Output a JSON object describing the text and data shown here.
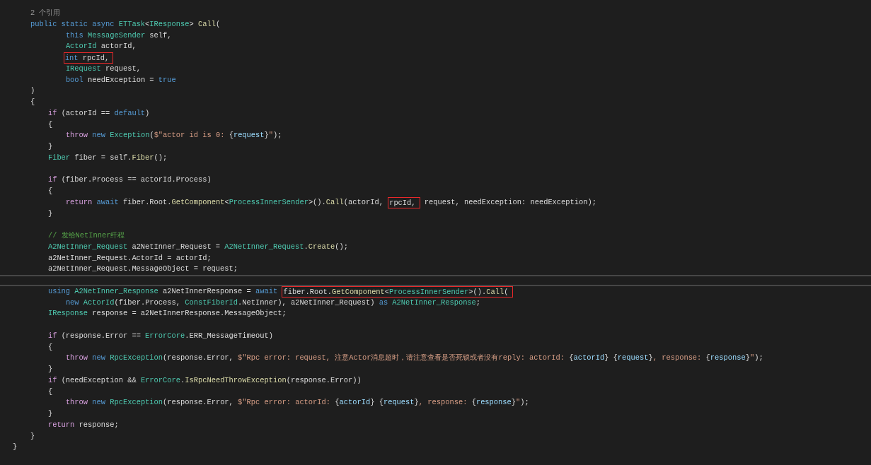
{
  "editor": {
    "lines": [
      {
        "kind": "codelens",
        "text": "    2 个引用"
      },
      {
        "kind": "code",
        "segments": [
          {
            "boxed": false,
            "tokens": [
              {
                "kind": "keyword",
                "text": "    public static async "
              },
              {
                "kind": "type",
                "text": "ETTask"
              },
              {
                "kind": "plain",
                "text": "<"
              },
              {
                "kind": "type",
                "text": "IResponse"
              },
              {
                "kind": "plain",
                "text": "> "
              },
              {
                "kind": "method",
                "text": "Call"
              },
              {
                "kind": "plain",
                "text": "("
              }
            ]
          }
        ]
      },
      {
        "kind": "code",
        "segments": [
          {
            "boxed": false,
            "tokens": [
              {
                "kind": "keyword",
                "text": "            this "
              },
              {
                "kind": "type",
                "text": "MessageSender"
              },
              {
                "kind": "plain",
                "text": " self,"
              }
            ]
          }
        ]
      },
      {
        "kind": "code",
        "segments": [
          {
            "boxed": false,
            "tokens": [
              {
                "kind": "type",
                "text": "            ActorId"
              },
              {
                "kind": "plain",
                "text": " actorId,"
              }
            ]
          }
        ]
      },
      {
        "kind": "code",
        "segments": [
          {
            "boxed": true,
            "tokens": [
              {
                "kind": "keyword",
                "text": "            int"
              },
              {
                "kind": "plain",
                "text": " rpcId,"
              }
            ]
          }
        ]
      },
      {
        "kind": "code",
        "segments": [
          {
            "boxed": false,
            "tokens": [
              {
                "kind": "type",
                "text": "            IRequest"
              },
              {
                "kind": "plain",
                "text": " request,"
              }
            ]
          }
        ]
      },
      {
        "kind": "code",
        "segments": [
          {
            "boxed": false,
            "tokens": [
              {
                "kind": "keyword",
                "text": "            bool"
              },
              {
                "kind": "plain",
                "text": " needException = "
              },
              {
                "kind": "keyword",
                "text": "true"
              }
            ]
          }
        ]
      },
      {
        "kind": "code",
        "segments": [
          {
            "boxed": false,
            "tokens": [
              {
                "kind": "plain",
                "text": "    )"
              }
            ]
          }
        ]
      },
      {
        "kind": "code",
        "segments": [
          {
            "boxed": false,
            "tokens": [
              {
                "kind": "plain",
                "text": "    {"
              }
            ]
          }
        ]
      },
      {
        "kind": "code",
        "segments": [
          {
            "boxed": false,
            "tokens": [
              {
                "kind": "control",
                "text": "        if"
              },
              {
                "kind": "plain",
                "text": " (actorId == "
              },
              {
                "kind": "keyword",
                "text": "default"
              },
              {
                "kind": "plain",
                "text": ")"
              }
            ]
          }
        ]
      },
      {
        "kind": "code",
        "segments": [
          {
            "boxed": false,
            "tokens": [
              {
                "kind": "plain",
                "text": "        {"
              }
            ]
          }
        ]
      },
      {
        "kind": "code",
        "segments": [
          {
            "boxed": false,
            "tokens": [
              {
                "kind": "control",
                "text": "            throw "
              },
              {
                "kind": "keyword",
                "text": "new "
              },
              {
                "kind": "type",
                "text": "Exception"
              },
              {
                "kind": "plain",
                "text": "("
              },
              {
                "kind": "string",
                "text": "$\"actor id is 0: "
              },
              {
                "kind": "plain",
                "text": "{"
              },
              {
                "kind": "interp",
                "text": "request"
              },
              {
                "kind": "plain",
                "text": "}"
              },
              {
                "kind": "string",
                "text": "\""
              },
              {
                "kind": "plain",
                "text": ");"
              }
            ]
          }
        ]
      },
      {
        "kind": "code",
        "segments": [
          {
            "boxed": false,
            "tokens": [
              {
                "kind": "plain",
                "text": "        }"
              }
            ]
          }
        ]
      },
      {
        "kind": "code",
        "segments": [
          {
            "boxed": false,
            "tokens": [
              {
                "kind": "type",
                "text": "        Fiber"
              },
              {
                "kind": "plain",
                "text": " fiber = self."
              },
              {
                "kind": "method",
                "text": "Fiber"
              },
              {
                "kind": "plain",
                "text": "();"
              }
            ]
          }
        ]
      },
      {
        "kind": "blank"
      },
      {
        "kind": "code",
        "segments": [
          {
            "boxed": false,
            "tokens": [
              {
                "kind": "control",
                "text": "        if"
              },
              {
                "kind": "plain",
                "text": " (fiber.Process == actorId.Process)"
              }
            ]
          }
        ]
      },
      {
        "kind": "code",
        "segments": [
          {
            "boxed": false,
            "tokens": [
              {
                "kind": "plain",
                "text": "        {"
              }
            ]
          }
        ]
      },
      {
        "kind": "code",
        "segments": [
          {
            "boxed": false,
            "tokens": [
              {
                "kind": "control",
                "text": "            return "
              },
              {
                "kind": "keyword",
                "text": "await"
              },
              {
                "kind": "plain",
                "text": " fiber.Root."
              },
              {
                "kind": "method",
                "text": "GetComponent"
              },
              {
                "kind": "plain",
                "text": "<"
              },
              {
                "kind": "type",
                "text": "ProcessInnerSender"
              },
              {
                "kind": "plain",
                "text": ">()."
              },
              {
                "kind": "method",
                "text": "Call"
              },
              {
                "kind": "plain",
                "text": "(actorId,"
              }
            ]
          },
          {
            "boxed": true,
            "tokens": [
              {
                "kind": "plain",
                "text": "rpcId,"
              }
            ]
          },
          {
            "boxed": false,
            "tokens": [
              {
                "kind": "plain",
                "text": "request, needException: needException);"
              }
            ]
          }
        ]
      },
      {
        "kind": "code",
        "segments": [
          {
            "boxed": false,
            "tokens": [
              {
                "kind": "plain",
                "text": "        }"
              }
            ]
          }
        ]
      },
      {
        "kind": "blank"
      },
      {
        "kind": "code",
        "segments": [
          {
            "boxed": false,
            "tokens": [
              {
                "kind": "comment",
                "text": "        // 发给NetInner纤程"
              }
            ]
          }
        ]
      },
      {
        "kind": "code",
        "segments": [
          {
            "boxed": false,
            "tokens": [
              {
                "kind": "type",
                "text": "        A2NetInner_Request"
              },
              {
                "kind": "plain",
                "text": " a2NetInner_Request = "
              },
              {
                "kind": "type",
                "text": "A2NetInner_Request"
              },
              {
                "kind": "plain",
                "text": "."
              },
              {
                "kind": "method",
                "text": "Create"
              },
              {
                "kind": "plain",
                "text": "();"
              }
            ]
          }
        ]
      },
      {
        "kind": "code",
        "segments": [
          {
            "boxed": false,
            "tokens": [
              {
                "kind": "plain",
                "text": "        a2NetInner_Request.ActorId = actorId;"
              }
            ]
          }
        ]
      },
      {
        "kind": "code",
        "segments": [
          {
            "boxed": false,
            "tokens": [
              {
                "kind": "plain",
                "text": "        a2NetInner_Request.MessageObject = request;"
              }
            ]
          }
        ]
      },
      {
        "kind": "separator"
      },
      {
        "kind": "code",
        "segments": [
          {
            "boxed": false,
            "tokens": [
              {
                "kind": "keyword",
                "text": "        using "
              },
              {
                "kind": "type",
                "text": "A2NetInner_Response"
              },
              {
                "kind": "plain",
                "text": " a2NetInnerResponse = "
              },
              {
                "kind": "keyword",
                "text": "await"
              }
            ]
          },
          {
            "boxed": true,
            "tokens": [
              {
                "kind": "plain",
                "text": "fiber.Root."
              },
              {
                "kind": "method",
                "text": "GetComponent"
              },
              {
                "kind": "plain",
                "text": "<"
              },
              {
                "kind": "type",
                "text": "ProcessInnerSender"
              },
              {
                "kind": "plain",
                "text": ">()."
              },
              {
                "kind": "method",
                "text": "Call"
              },
              {
                "kind": "plain",
                "text": "("
              }
            ]
          }
        ]
      },
      {
        "kind": "code",
        "segments": [
          {
            "boxed": false,
            "tokens": [
              {
                "kind": "keyword",
                "text": "            new "
              },
              {
                "kind": "type",
                "text": "ActorId"
              },
              {
                "kind": "plain",
                "text": "(fiber.Process, "
              },
              {
                "kind": "type",
                "text": "ConstFiberId"
              },
              {
                "kind": "plain",
                "text": ".NetInner), a2NetInner_Request) "
              },
              {
                "kind": "keyword",
                "text": "as "
              },
              {
                "kind": "type",
                "text": "A2NetInner_Response"
              },
              {
                "kind": "plain",
                "text": ";"
              }
            ]
          }
        ]
      },
      {
        "kind": "code",
        "segments": [
          {
            "boxed": false,
            "tokens": [
              {
                "kind": "type",
                "text": "        IResponse"
              },
              {
                "kind": "plain",
                "text": " response = a2NetInnerResponse.MessageObject;"
              }
            ]
          }
        ]
      },
      {
        "kind": "blank"
      },
      {
        "kind": "code",
        "segments": [
          {
            "boxed": false,
            "tokens": [
              {
                "kind": "control",
                "text": "        if"
              },
              {
                "kind": "plain",
                "text": " (response.Error == "
              },
              {
                "kind": "type",
                "text": "ErrorCore"
              },
              {
                "kind": "plain",
                "text": ".ERR_MessageTimeout)"
              }
            ]
          }
        ]
      },
      {
        "kind": "code",
        "segments": [
          {
            "boxed": false,
            "tokens": [
              {
                "kind": "plain",
                "text": "        {"
              }
            ]
          }
        ]
      },
      {
        "kind": "code",
        "segments": [
          {
            "boxed": false,
            "tokens": [
              {
                "kind": "control",
                "text": "            throw "
              },
              {
                "kind": "keyword",
                "text": "new "
              },
              {
                "kind": "type",
                "text": "RpcException"
              },
              {
                "kind": "plain",
                "text": "(response.Error, "
              },
              {
                "kind": "string",
                "text": "$\"Rpc error: request, 注意Actor消息超时，请注意查看是否死锁或者没有reply: actorId: "
              },
              {
                "kind": "plain",
                "text": "{"
              },
              {
                "kind": "interp",
                "text": "actorId"
              },
              {
                "kind": "plain",
                "text": "} {"
              },
              {
                "kind": "interp",
                "text": "request"
              },
              {
                "kind": "plain",
                "text": "}"
              },
              {
                "kind": "string",
                "text": ", response: "
              },
              {
                "kind": "plain",
                "text": "{"
              },
              {
                "kind": "interp",
                "text": "response"
              },
              {
                "kind": "plain",
                "text": "}"
              },
              {
                "kind": "string",
                "text": "\""
              },
              {
                "kind": "plain",
                "text": ");"
              }
            ]
          }
        ]
      },
      {
        "kind": "code",
        "segments": [
          {
            "boxed": false,
            "tokens": [
              {
                "kind": "plain",
                "text": "        }"
              }
            ]
          }
        ]
      },
      {
        "kind": "code",
        "segments": [
          {
            "boxed": false,
            "tokens": [
              {
                "kind": "control",
                "text": "        if"
              },
              {
                "kind": "plain",
                "text": " (needException && "
              },
              {
                "kind": "type",
                "text": "ErrorCore"
              },
              {
                "kind": "plain",
                "text": "."
              },
              {
                "kind": "method",
                "text": "IsRpcNeedThrowException"
              },
              {
                "kind": "plain",
                "text": "(response.Error))"
              }
            ]
          }
        ]
      },
      {
        "kind": "code",
        "segments": [
          {
            "boxed": false,
            "tokens": [
              {
                "kind": "plain",
                "text": "        {"
              }
            ]
          }
        ]
      },
      {
        "kind": "code",
        "segments": [
          {
            "boxed": false,
            "tokens": [
              {
                "kind": "control",
                "text": "            throw "
              },
              {
                "kind": "keyword",
                "text": "new "
              },
              {
                "kind": "type",
                "text": "RpcException"
              },
              {
                "kind": "plain",
                "text": "(response.Error, "
              },
              {
                "kind": "string",
                "text": "$\"Rpc error: actorId: "
              },
              {
                "kind": "plain",
                "text": "{"
              },
              {
                "kind": "interp",
                "text": "actorId"
              },
              {
                "kind": "plain",
                "text": "} {"
              },
              {
                "kind": "interp",
                "text": "request"
              },
              {
                "kind": "plain",
                "text": "}"
              },
              {
                "kind": "string",
                "text": ", response: "
              },
              {
                "kind": "plain",
                "text": "{"
              },
              {
                "kind": "interp",
                "text": "response"
              },
              {
                "kind": "plain",
                "text": "}"
              },
              {
                "kind": "string",
                "text": "\""
              },
              {
                "kind": "plain",
                "text": ");"
              }
            ]
          }
        ]
      },
      {
        "kind": "code",
        "segments": [
          {
            "boxed": false,
            "tokens": [
              {
                "kind": "plain",
                "text": "        }"
              }
            ]
          }
        ]
      },
      {
        "kind": "code",
        "segments": [
          {
            "boxed": false,
            "tokens": [
              {
                "kind": "control",
                "text": "        return"
              },
              {
                "kind": "plain",
                "text": " response;"
              }
            ]
          }
        ]
      },
      {
        "kind": "code",
        "segments": [
          {
            "boxed": false,
            "tokens": [
              {
                "kind": "plain",
                "text": "    }"
              }
            ]
          }
        ]
      },
      {
        "kind": "code",
        "segments": [
          {
            "boxed": false,
            "tokens": [
              {
                "kind": "plain",
                "text": "}"
              }
            ]
          }
        ]
      }
    ]
  }
}
